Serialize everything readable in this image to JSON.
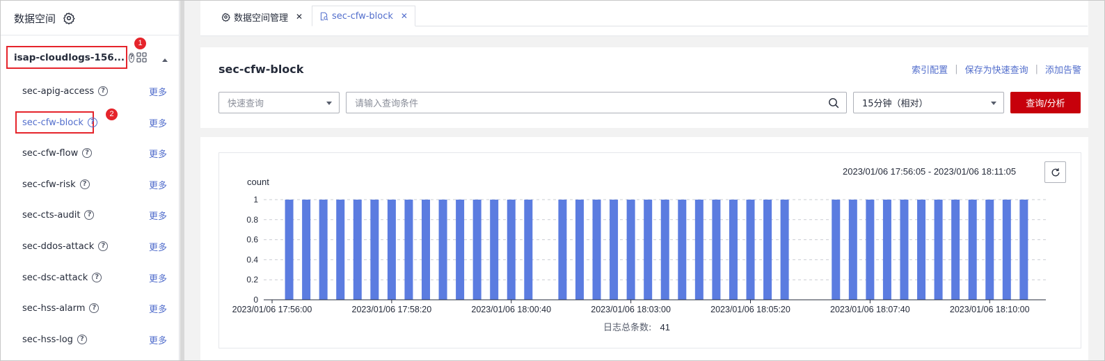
{
  "sidebar": {
    "title": "数据空间",
    "workspace_name": "isap-cloudlogs-156...",
    "more_label": "更多",
    "badge_1": "1",
    "badge_2": "2",
    "streams": [
      {
        "name": "sec-apig-access"
      },
      {
        "name": "sec-cfw-block",
        "active": true
      },
      {
        "name": "sec-cfw-flow"
      },
      {
        "name": "sec-cfw-risk"
      },
      {
        "name": "sec-cts-audit"
      },
      {
        "name": "sec-ddos-attack"
      },
      {
        "name": "sec-dsc-attack"
      },
      {
        "name": "sec-hss-alarm"
      },
      {
        "name": "sec-hss-log"
      }
    ]
  },
  "tabs": [
    {
      "label": "数据空间管理",
      "icon": "gear-icon"
    },
    {
      "label": "sec-cfw-block",
      "icon": "search-doc-icon",
      "active": true
    }
  ],
  "query": {
    "title": "sec-cfw-block",
    "links": [
      "索引配置",
      "保存为快速查询",
      "添加告警"
    ],
    "quick_placeholder": "快速查询",
    "input_placeholder": "请输入查询条件",
    "time_value": "15分钟（相对）",
    "button_label": "查询/分析"
  },
  "chart": {
    "time_range": "2023/01/06 17:56:05 - 2023/01/06 18:11:05",
    "total_label": "日志总条数:",
    "total_value": "41"
  },
  "colors": {
    "accent": "#526ecc",
    "bar": "#5b7ce0",
    "primary_button": "#c7000b",
    "highlight_box": "#e5242b"
  },
  "chart_data": {
    "type": "bar",
    "ylabel": "count",
    "ylim": [
      0,
      1
    ],
    "yticks": [
      "0",
      "0.2",
      "0.4",
      "0.6",
      "0.8",
      "1"
    ],
    "xticks": [
      "2023/01/06 17:56:00",
      "2023/01/06 17:58:20",
      "2023/01/06 18:00:40",
      "2023/01/06 18:03:00",
      "2023/01/06 18:05:20",
      "2023/01/06 18:07:40",
      "2023/01/06 18:10:00"
    ],
    "x_range": [
      "2023/01/06 17:56:00",
      "2023/01/06 18:10:56"
    ],
    "bar_times": [
      "2023/01/06 17:56:20",
      "2023/01/06 17:56:40",
      "2023/01/06 17:57:00",
      "2023/01/06 17:57:20",
      "2023/01/06 17:57:40",
      "2023/01/06 17:58:00",
      "2023/01/06 17:58:20",
      "2023/01/06 17:58:40",
      "2023/01/06 17:59:00",
      "2023/01/06 17:59:20",
      "2023/01/06 17:59:40",
      "2023/01/06 18:00:00",
      "2023/01/06 18:00:20",
      "2023/01/06 18:00:40",
      "2023/01/06 18:01:00",
      "2023/01/06 18:01:40",
      "2023/01/06 18:02:00",
      "2023/01/06 18:02:20",
      "2023/01/06 18:02:40",
      "2023/01/06 18:03:00",
      "2023/01/06 18:03:20",
      "2023/01/06 18:03:40",
      "2023/01/06 18:04:00",
      "2023/01/06 18:04:20",
      "2023/01/06 18:04:40",
      "2023/01/06 18:05:00",
      "2023/01/06 18:05:20",
      "2023/01/06 18:05:40",
      "2023/01/06 18:06:00",
      "2023/01/06 18:07:00",
      "2023/01/06 18:07:20",
      "2023/01/06 18:07:40",
      "2023/01/06 18:08:00",
      "2023/01/06 18:08:20",
      "2023/01/06 18:08:40",
      "2023/01/06 18:09:00",
      "2023/01/06 18:09:20",
      "2023/01/06 18:09:40",
      "2023/01/06 18:10:00",
      "2023/01/06 18:10:20",
      "2023/01/06 18:10:40"
    ],
    "values": [
      1,
      1,
      1,
      1,
      1,
      1,
      1,
      1,
      1,
      1,
      1,
      1,
      1,
      1,
      1,
      1,
      1,
      1,
      1,
      1,
      1,
      1,
      1,
      1,
      1,
      1,
      1,
      1,
      1,
      1,
      1,
      1,
      1,
      1,
      1,
      1,
      1,
      1,
      1,
      1,
      1
    ],
    "grid": true,
    "legend": "none"
  }
}
